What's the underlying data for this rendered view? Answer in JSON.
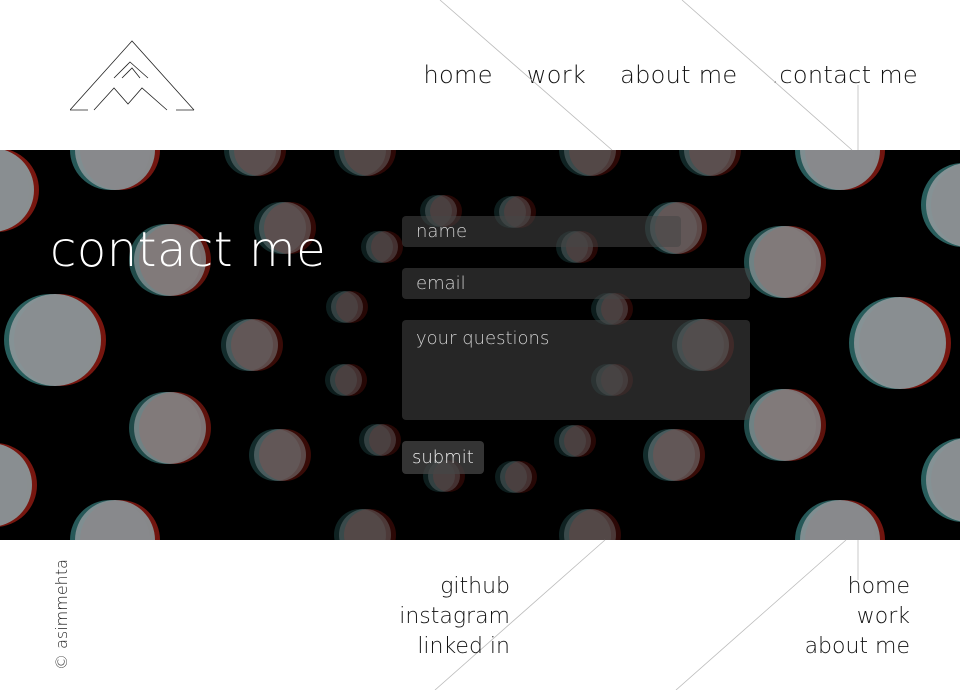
{
  "nav": {
    "items": [
      {
        "label": "home"
      },
      {
        "label": "work"
      },
      {
        "label": "about me"
      },
      {
        "label": ".contact me"
      }
    ]
  },
  "hero": {
    "title": "contact me"
  },
  "form": {
    "name_placeholder": "name",
    "email_placeholder": "email",
    "questions_placeholder": "your questions",
    "submit_label": "submit"
  },
  "footer": {
    "copyright": "© asimmehta",
    "social": [
      {
        "label": "github"
      },
      {
        "label": "instagram"
      },
      {
        "label": "linked in"
      }
    ],
    "nav": [
      {
        "label": "home"
      },
      {
        "label": "work"
      },
      {
        "label": "about me"
      }
    ]
  },
  "colors": {
    "hero_bg": "#000000",
    "bokeh_fill": "#8a9598",
    "bokeh_red": "#8b1a12",
    "bokeh_teal": "#2f6d6c"
  }
}
